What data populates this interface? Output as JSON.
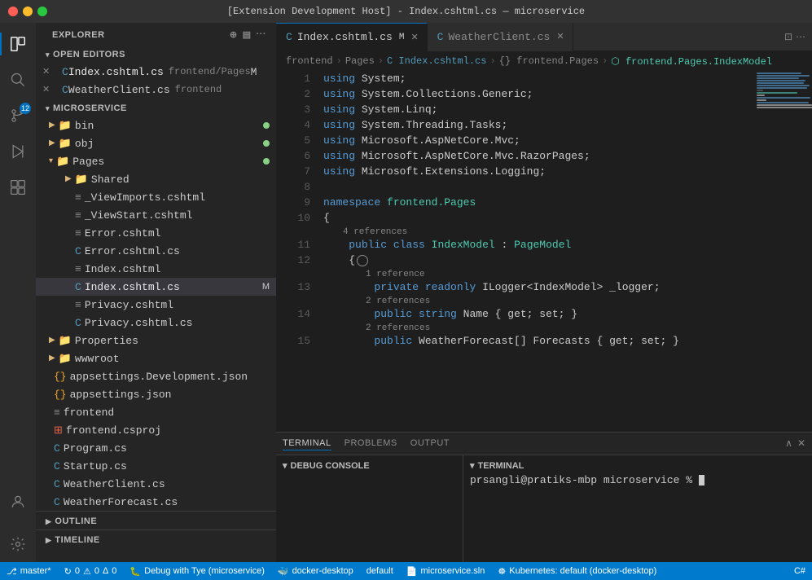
{
  "titleBar": {
    "text": "[Extension Development Host] - Index.cshtml.cs — microservice"
  },
  "activityBar": {
    "icons": [
      {
        "name": "explorer-icon",
        "symbol": "⎘",
        "active": true,
        "badge": null
      },
      {
        "name": "search-icon",
        "symbol": "🔍",
        "active": false
      },
      {
        "name": "source-control-icon",
        "symbol": "⑂",
        "active": false,
        "badge": "12"
      },
      {
        "name": "run-icon",
        "symbol": "▷",
        "active": false
      },
      {
        "name": "extensions-icon",
        "symbol": "⊞",
        "active": false
      },
      {
        "name": "remote-icon",
        "symbol": "⊡",
        "active": false
      },
      {
        "name": "account-icon",
        "symbol": "⊙",
        "active": false
      },
      {
        "name": "settings-icon",
        "symbol": "⚙",
        "active": false
      }
    ]
  },
  "sidebar": {
    "title": "EXPLORER",
    "sections": {
      "openEditors": {
        "label": "OPEN EDITORS",
        "items": [
          {
            "name": "Index.cshtml.cs",
            "path": "frontend/Pages",
            "modified": "M",
            "type": "razor-cs",
            "active": true
          },
          {
            "name": "WeatherClient.cs",
            "path": "frontend",
            "modified": "",
            "type": "cs",
            "active": false
          }
        ]
      },
      "microservice": {
        "label": "MICROSERVICE",
        "items": [
          {
            "name": "bin",
            "type": "folder",
            "indent": 1,
            "badge": true
          },
          {
            "name": "obj",
            "type": "folder",
            "indent": 1,
            "badge": true
          },
          {
            "name": "Pages",
            "type": "folder",
            "indent": 1,
            "badge": true,
            "expanded": true
          },
          {
            "name": "Shared",
            "type": "folder",
            "indent": 2
          },
          {
            "name": "_ViewImports.cshtml",
            "type": "cshtml",
            "indent": 2
          },
          {
            "name": "_ViewStart.cshtml",
            "type": "cshtml",
            "indent": 2
          },
          {
            "name": "Error.cshtml",
            "type": "cshtml",
            "indent": 2
          },
          {
            "name": "Error.cshtml.cs",
            "type": "cs",
            "indent": 2
          },
          {
            "name": "Index.cshtml",
            "type": "cshtml",
            "indent": 2
          },
          {
            "name": "Index.cshtml.cs",
            "type": "cs",
            "indent": 2,
            "active": true,
            "modified": "M"
          },
          {
            "name": "Privacy.cshtml",
            "type": "cshtml",
            "indent": 2
          },
          {
            "name": "Privacy.cshtml.cs",
            "type": "cs",
            "indent": 2
          },
          {
            "name": "Properties",
            "type": "folder",
            "indent": 1
          },
          {
            "name": "wwwroot",
            "type": "folder",
            "indent": 1
          },
          {
            "name": "appsettings.Development.json",
            "type": "json",
            "indent": 1
          },
          {
            "name": "appsettings.json",
            "type": "json",
            "indent": 1
          },
          {
            "name": "frontend",
            "type": "file",
            "indent": 1
          },
          {
            "name": "frontend.csproj",
            "type": "csproj",
            "indent": 1
          },
          {
            "name": "Program.cs",
            "type": "cs",
            "indent": 1
          },
          {
            "name": "Startup.cs",
            "type": "cs",
            "indent": 1
          },
          {
            "name": "WeatherClient.cs",
            "type": "cs",
            "indent": 1
          },
          {
            "name": "WeatherForecast.cs",
            "type": "cs",
            "indent": 1
          }
        ]
      }
    },
    "outline": "OUTLINE",
    "timeline": "TIMELINE"
  },
  "editor": {
    "tabs": [
      {
        "label": "Index.cshtml.cs",
        "type": "razor-cs",
        "modified": "M",
        "active": true
      },
      {
        "label": "WeatherClient.cs",
        "type": "cs",
        "modified": "",
        "active": false
      }
    ],
    "breadcrumb": [
      "frontend",
      "Pages",
      "Index.cshtml.cs",
      "{} frontend.Pages",
      "frontend.Pages.IndexModel"
    ],
    "lines": [
      {
        "num": 1,
        "code": "<kw>using</kw> System;"
      },
      {
        "num": 2,
        "code": "<kw>using</kw> System.Collections.Generic;"
      },
      {
        "num": 3,
        "code": "<kw>using</kw> System.Linq;"
      },
      {
        "num": 4,
        "code": "<kw>using</kw> System.Threading.Tasks;"
      },
      {
        "num": 5,
        "code": "<kw>using</kw> Microsoft.AspNetCore.Mvc;"
      },
      {
        "num": 6,
        "code": "<kw>using</kw> Microsoft.AspNetCore.Mvc.RazorPages;"
      },
      {
        "num": 7,
        "code": "<kw>using</kw> Microsoft.Extensions.Logging;"
      },
      {
        "num": 8,
        "code": ""
      },
      {
        "num": 9,
        "code": "<kw>namespace</kw> <ns>frontend.Pages</ns>"
      },
      {
        "num": 10,
        "code": "{"
      },
      {
        "num": "ref4",
        "ref": "4 references"
      },
      {
        "num": 11,
        "code": "    <kw>public</kw> <kw>class</kw> <type>IndexModel</type> : <type>PageModel</type>"
      },
      {
        "num": 12,
        "code": "    {"
      },
      {
        "num": "ref1",
        "ref": "1 reference"
      },
      {
        "num": 13,
        "code": "        <kw>private</kw> <kw>readonly</kw> ILogger&lt;IndexModel&gt; _logger;"
      },
      {
        "num": "ref2a",
        "ref": "2 references"
      },
      {
        "num": 14,
        "code": "        <kw>public</kw> <kw>string</kw> Name { get; set; }"
      },
      {
        "num": "ref2b",
        "ref": "2 references"
      },
      {
        "num": 15,
        "code": "        <kw>public</kw> WeatherForecast[] Forecasts { get; set; }"
      }
    ]
  },
  "terminal": {
    "tabs": [
      "TERMINAL",
      "PROBLEMS",
      "OUTPUT"
    ],
    "activeTab": "TERMINAL",
    "debugConsoleLabel": "DEBUG CONSOLE",
    "terminalLabel": "TERMINAL",
    "terminalLine": "prsangli@pratiks-mbp microservice % "
  },
  "statusBar": {
    "branch": "⎇ master*",
    "sync": "↻ 0",
    "warnings": "⚠ 0 Δ 0",
    "debug": "Debug with Tye (microservice)",
    "docker": "docker-desktop",
    "default": "default",
    "solution": "microservice.sln",
    "kubernetes": "Kubernetes: default (docker-desktop)",
    "lang": "C#"
  }
}
